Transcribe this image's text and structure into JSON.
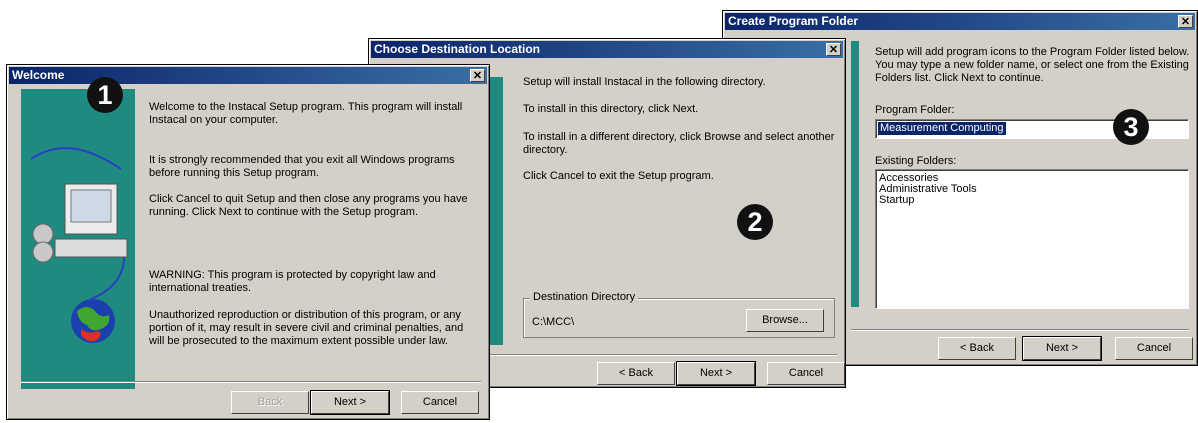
{
  "welcome": {
    "title": "Welcome",
    "marker": "1",
    "paragraphs": [
      "Welcome to the Instacal Setup program.  This program will install Instacal on your computer.",
      "It is strongly recommended that you exit all Windows programs before running this Setup program.",
      "Click Cancel to quit Setup and then close any programs you have running.  Click Next to continue with the Setup program.",
      "WARNING: This program is protected by copyright law and international treaties.",
      "Unauthorized reproduction or distribution of this program, or any portion of it, may result in severe civil and criminal penalties, and will be prosecuted to the maximum extent possible under law."
    ],
    "back_label": "Back",
    "next_label": "Next >",
    "cancel_label": "Cancel"
  },
  "destination": {
    "title": "Choose Destination Location",
    "marker": "2",
    "paragraphs": [
      "Setup will install Instacal in the following directory.",
      "To install in this directory, click Next.",
      "To install in a different directory, click Browse and select another directory.",
      "Click Cancel to exit the Setup program."
    ],
    "group_label": "Destination Directory",
    "path": "C:\\MCC\\",
    "browse_label": "Browse...",
    "back_label": "< Back",
    "next_label": "Next >",
    "cancel_label": "Cancel"
  },
  "folder": {
    "title": "Create Program Folder",
    "marker": "3",
    "intro": "Setup will add program icons to the Program Folder listed below. You may type a new folder name, or select one from the Existing Folders list.  Click Next to continue.",
    "program_folder_label": "Program Folder:",
    "program_folder_value": "Measurement Computing",
    "existing_label": "Existing Folders:",
    "existing_items": [
      "Accessories",
      "Administrative Tools",
      "Startup"
    ],
    "back_label": "< Back",
    "next_label": "Next >",
    "cancel_label": "Cancel"
  },
  "colors": {
    "title_active": "#0a246a",
    "dialog_face": "#d4d0c8",
    "teal_panel": "#1f8b80",
    "selection": "#0a246a"
  }
}
